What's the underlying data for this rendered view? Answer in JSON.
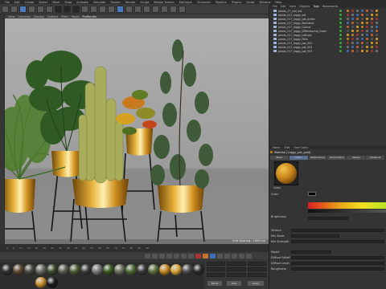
{
  "menubar": {
    "items": [
      "File",
      "Edit",
      "Create",
      "Select",
      "Mesh",
      "Snap",
      "Animate",
      "Simulate",
      "Tracker",
      "Render",
      "Sculpt",
      "Motion Tracker",
      "MoGraph",
      "Character",
      "Pipeline",
      "Plugins",
      "Script",
      "Window",
      "Help"
    ]
  },
  "viewport": {
    "tabs": [
      "View",
      "Cameras",
      "Display",
      "Options",
      "Filter",
      "Panel",
      "ProRender"
    ],
    "active_tab": "ProRender",
    "footer_text": "Grid Spacing : 1000 cm"
  },
  "timeline": {
    "ticks": [
      "0",
      "5",
      "10",
      "15",
      "20",
      "25",
      "30",
      "35",
      "40",
      "45",
      "50",
      "55",
      "60",
      "65",
      "70",
      "75",
      "80",
      "85",
      "90"
    ]
  },
  "materials": {
    "balls": [
      {
        "color": "#2f2f2f"
      },
      {
        "color": "#5d4a2e"
      },
      {
        "color": "#4a4a42"
      },
      {
        "color": "#6a6a64"
      },
      {
        "color": "#3a4a2a"
      },
      {
        "color": "#5c5a4e"
      },
      {
        "color": "#4d5e34"
      },
      {
        "color": "#3c3c3c"
      },
      {
        "color": "#777"
      },
      {
        "color": "#3a5a22"
      },
      {
        "color": "#6b6e5a"
      },
      {
        "color": "#4d6b33"
      },
      {
        "color": "#3a3a3a"
      },
      {
        "color": "#5b6e3f"
      },
      {
        "color": "#c58a22"
      },
      {
        "color": "#d7a63a"
      },
      {
        "color": "#4b4b4b"
      },
      {
        "color": "#2a2a2a"
      },
      {
        "color": "#c88e2a"
      },
      {
        "color": "#1a1a1a"
      }
    ]
  },
  "coords": {
    "apply_label": "Apply",
    "world_label": "World",
    "size_label": "Size"
  },
  "objman": {
    "tabs": [
      "File",
      "Edit",
      "View",
      "Objects",
      "Tags",
      "Bookmarks"
    ],
    "active_tab": "Tags",
    "objects": [
      {
        "name": "plants_17_null_set"
      },
      {
        "name": "plants_017_leggy_set"
      },
      {
        "name": "plants_017_leggy_pot_draftz"
      },
      {
        "name": "plants_017_leggy_Monstera"
      },
      {
        "name": "plants_017_leggy_Cactus"
      },
      {
        "name": "plants_017_leggy_Diffenbachia_Geometria"
      },
      {
        "name": "plants_017_leggy_Lettuce"
      },
      {
        "name": "plants_017_leggy_Palm"
      },
      {
        "name": "plants_017_leggy_pot_001"
      },
      {
        "name": "plants_017_leggy_pot_002"
      },
      {
        "name": "plants_017_leggy_pot_003"
      }
    ]
  },
  "attributes": {
    "tabs": [
      "Mode",
      "Edit",
      "User Data"
    ],
    "title": "Material [Leggy_pot_gold]",
    "subtabs": [
      "Basic",
      "Color",
      "Reflectance",
      "Illumination",
      "Assign",
      "Viewport"
    ],
    "selected_subtab": "Color",
    "labels": [
      "Color",
      "Color",
      "Brightness",
      "Texture",
      "Mix Mode",
      "Mix Strength",
      "Model",
      "Diffuse Falloff",
      "Diffuse Level",
      "Roughness"
    ]
  }
}
